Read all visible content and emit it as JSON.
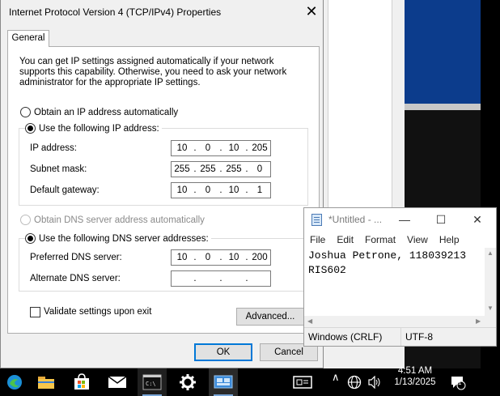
{
  "dialog": {
    "title": "Internet Protocol Version 4 (TCP/IPv4) Properties",
    "close_glyph": "✕",
    "tab_general": "General",
    "intro": "You can get IP settings assigned automatically if your network supports this capability. Otherwise, you need to ask your network administrator for the appropriate IP settings.",
    "radio_auto_ip": "Obtain an IP address automatically",
    "radio_manual_ip": "Use the following IP address:",
    "ip_address_label": "IP address:",
    "ip_address": [
      "10",
      "0",
      "10",
      "205"
    ],
    "subnet_label": "Subnet mask:",
    "subnet": [
      "255",
      "255",
      "255",
      "0"
    ],
    "gateway_label": "Default gateway:",
    "gateway": [
      "10",
      "0",
      "10",
      "1"
    ],
    "radio_auto_dns": "Obtain DNS server address automatically",
    "radio_manual_dns": "Use the following DNS server addresses:",
    "pref_dns_label": "Preferred DNS server:",
    "pref_dns": [
      "10",
      "0",
      "10",
      "200"
    ],
    "alt_dns_label": "Alternate DNS server:",
    "alt_dns": [
      "",
      "",
      "",
      ""
    ],
    "validate_label": "Validate settings upon exit",
    "advanced_button": "Advanced...",
    "ok_button": "OK",
    "cancel_button": "Cancel"
  },
  "notepad": {
    "title": "*Untitled - ...",
    "minimize": "—",
    "maximize": "☐",
    "close": "✕",
    "menu": [
      "File",
      "Edit",
      "Format",
      "View",
      "Help"
    ],
    "text": "Joshua Petrone, 118039213\nRIS602",
    "status_eol": "Windows (CRLF)",
    "status_encoding": "UTF-8"
  },
  "taskbar": {
    "time": "4:51 AM",
    "date": "1/13/2025",
    "notification_count": "1",
    "icons": [
      "edge-icon",
      "file-explorer-icon",
      "store-icon",
      "mail-icon",
      "cmd-icon",
      "settings-icon",
      "network-connections-icon"
    ]
  },
  "colors": {
    "accent": "#0078d7",
    "bg_blue": "#0c3c8c"
  }
}
